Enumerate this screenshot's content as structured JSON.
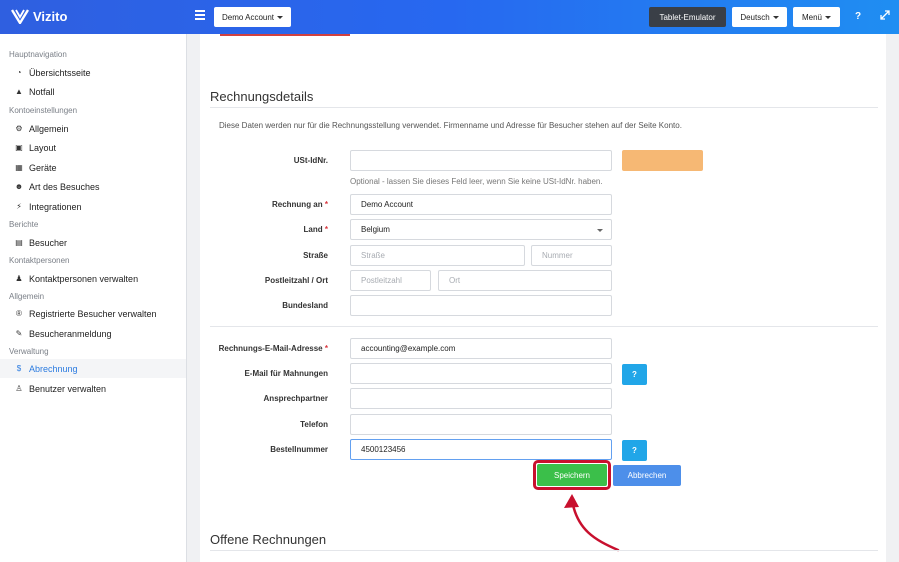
{
  "header": {
    "brand": "Vizito",
    "account_dropdown": "Demo Account",
    "tablet_button": "Tablet-Emulator",
    "language_dropdown": "Deutsch",
    "menu_dropdown": "Menü",
    "help_icon": "?"
  },
  "sidebar": {
    "sections": [
      {
        "heading": "Hauptnavigation",
        "items": [
          {
            "label": "Übersichtsseite",
            "icon": "dashboard-icon"
          },
          {
            "label": "Notfall",
            "icon": "warning-icon"
          }
        ]
      },
      {
        "heading": "Kontoeinstellungen",
        "items": [
          {
            "label": "Allgemein",
            "icon": "gear-icon"
          },
          {
            "label": "Layout",
            "icon": "image-icon"
          },
          {
            "label": "Geräte",
            "icon": "devices-icon"
          },
          {
            "label": "Art des Besuches",
            "icon": "users-icon"
          },
          {
            "label": "Integrationen",
            "icon": "plug-icon"
          }
        ]
      },
      {
        "heading": "Berichte",
        "items": [
          {
            "label": "Besucher",
            "icon": "book-icon"
          }
        ]
      },
      {
        "heading": "Kontaktpersonen",
        "items": [
          {
            "label": "Kontaktpersonen verwalten",
            "icon": "person-icon"
          }
        ]
      },
      {
        "heading": "Allgemein",
        "items": [
          {
            "label": "Registrierte Besucher verwalten",
            "icon": "registered-icon"
          },
          {
            "label": "Besucheranmeldung",
            "icon": "pencil-icon"
          }
        ]
      },
      {
        "heading": "Verwaltung",
        "items": [
          {
            "label": "Abrechnung",
            "icon": "dollar-icon",
            "active": true
          },
          {
            "label": "Benutzer verwalten",
            "icon": "user-plus-icon"
          }
        ]
      }
    ]
  },
  "main": {
    "section_title": "Rechnungsdetails",
    "description": "Diese Daten werden nur für die Rechnungsstellung verwendet. Firmenname und Adresse für Besucher stehen auf der Seite Konto.",
    "vat": {
      "label": "USt-IdNr.",
      "value": "",
      "hint": "Optional - lassen Sie dieses Feld leer, wenn Sie keine USt-IdNr. haben."
    },
    "bill_to": {
      "label": "Rechnung an",
      "value": "Demo Account"
    },
    "country": {
      "label": "Land",
      "value": "Belgium"
    },
    "street": {
      "label": "Straße",
      "placeholder": "Straße",
      "number_placeholder": "Nummer"
    },
    "zip_city": {
      "label": "Postleitzahl / Ort",
      "zip_placeholder": "Postleitzahl",
      "city_placeholder": "Ort"
    },
    "state": {
      "label": "Bundesland",
      "value": ""
    },
    "billing_email": {
      "label": "Rechnungs-E-Mail-Adresse",
      "value": "accounting@example.com"
    },
    "reminder_email": {
      "label": "E-Mail für Mahnungen",
      "value": ""
    },
    "contact_person": {
      "label": "Ansprechpartner",
      "value": ""
    },
    "phone": {
      "label": "Telefon",
      "value": ""
    },
    "order_number": {
      "label": "Bestellnummer",
      "value": "4500123456"
    },
    "required_mark": "*",
    "help_mark": "?",
    "save_label": "Speichern",
    "cancel_label": "Abbrechen",
    "open_invoices_title": "Offene Rechnungen"
  },
  "colors": {
    "accent": "#2b7be0",
    "save": "#3bbf4a",
    "highlight": "#c8102e"
  }
}
